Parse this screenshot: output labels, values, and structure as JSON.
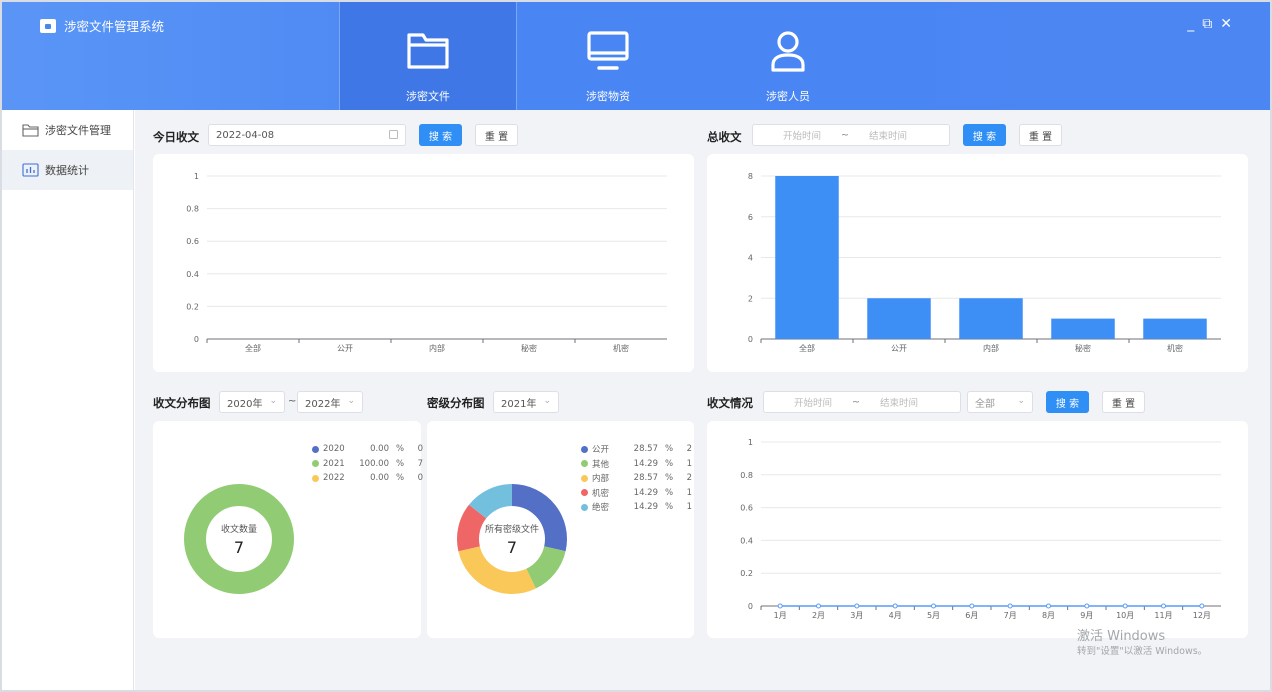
{
  "app": {
    "title": "涉密文件管理系统"
  },
  "nav": [
    {
      "label": "涉密文件",
      "icon": "folder-icon",
      "active": true
    },
    {
      "label": "涉密物资",
      "icon": "monitor-icon",
      "active": false
    },
    {
      "label": "涉密人员",
      "icon": "user-icon",
      "active": false
    }
  ],
  "window": {
    "minimize": "_",
    "restore": "⧉",
    "close": "✕"
  },
  "sidebar": [
    {
      "label": "涉密文件管理",
      "icon": "folder-icon",
      "active": false
    },
    {
      "label": "数据统计",
      "icon": "bar-chart-icon",
      "active": true
    }
  ],
  "today": {
    "title": "今日收文",
    "date": "2022-04-08",
    "search": "搜 索",
    "reset": "重 置"
  },
  "total": {
    "title": "总收文",
    "start_placeholder": "开始时间",
    "sep": "~",
    "end_placeholder": "结束时间",
    "search": "搜 索",
    "reset": "重 置"
  },
  "distribution": {
    "title": "收文分布图",
    "from": "2020年",
    "sep": "~",
    "to": "2022年",
    "center_label": "收文数量",
    "center_value": "7"
  },
  "secret": {
    "title": "密级分布图",
    "year": "2021年",
    "center_label": "所有密级文件",
    "center_value": "7"
  },
  "situation": {
    "title": "收文情况",
    "start_placeholder": "开始时间",
    "sep": "~",
    "end_placeholder": "结束时间",
    "type": "全部",
    "search": "搜 索",
    "reset": "重 置"
  },
  "watermark": {
    "line1": "激活 Windows",
    "line2": "转到\"设置\"以激活 Windows。"
  },
  "colors": {
    "primary": "#4a86f3",
    "bar": "#3d8ef5",
    "green": "#91cc75",
    "navy": "#5470c6",
    "yellow": "#fac858",
    "red": "#ee6666",
    "cyan": "#73c0de"
  },
  "chart_data": [
    {
      "type": "bar",
      "title": "今日收文",
      "categories": [
        "全部",
        "公开",
        "内部",
        "秘密",
        "机密"
      ],
      "values": [
        0,
        0,
        0,
        0,
        0
      ],
      "ylim": [
        0,
        1
      ],
      "yticks": [
        "0",
        "0.2",
        "0.4",
        "0.6",
        "0.8",
        "1"
      ],
      "grid": true
    },
    {
      "type": "bar",
      "title": "总收文",
      "categories": [
        "全部",
        "公开",
        "内部",
        "秘密",
        "机密"
      ],
      "values": [
        8,
        2,
        2,
        1,
        1
      ],
      "ylim": [
        0,
        8
      ],
      "yticks": [
        "0",
        "2",
        "4",
        "6",
        "8"
      ],
      "grid": true
    },
    {
      "type": "pie",
      "title": "收文分布图",
      "legend_position": "top-right",
      "slices": [
        {
          "label": "2020",
          "percent": "0.00",
          "unit": "%",
          "count": 0,
          "color": "#5470c6"
        },
        {
          "label": "2021",
          "percent": "100.00",
          "unit": "%",
          "count": 7,
          "color": "#91cc75"
        },
        {
          "label": "2022",
          "percent": "0.00",
          "unit": "%",
          "count": 0,
          "color": "#fac858"
        }
      ]
    },
    {
      "type": "pie",
      "title": "密级分布图",
      "legend_position": "top-right",
      "slices": [
        {
          "label": "公开",
          "percent": "28.57",
          "unit": "%",
          "count": 2,
          "color": "#5470c6"
        },
        {
          "label": "其他",
          "percent": "14.29",
          "unit": "%",
          "count": 1,
          "color": "#91cc75"
        },
        {
          "label": "内部",
          "percent": "28.57",
          "unit": "%",
          "count": 2,
          "color": "#fac858"
        },
        {
          "label": "机密",
          "percent": "14.29",
          "unit": "%",
          "count": 1,
          "color": "#ee6666"
        },
        {
          "label": "绝密",
          "percent": "14.29",
          "unit": "%",
          "count": 1,
          "color": "#73c0de"
        }
      ]
    },
    {
      "type": "line",
      "title": "收文情况",
      "categories": [
        "1月",
        "2月",
        "3月",
        "4月",
        "5月",
        "6月",
        "7月",
        "8月",
        "9月",
        "10月",
        "11月",
        "12月"
      ],
      "values": [
        0,
        0,
        0,
        0,
        0,
        0,
        0,
        0,
        0,
        0,
        0,
        0
      ],
      "ylim": [
        0,
        1
      ],
      "yticks": [
        "0",
        "0.2",
        "0.4",
        "0.6",
        "0.8",
        "1"
      ],
      "grid": true
    }
  ]
}
